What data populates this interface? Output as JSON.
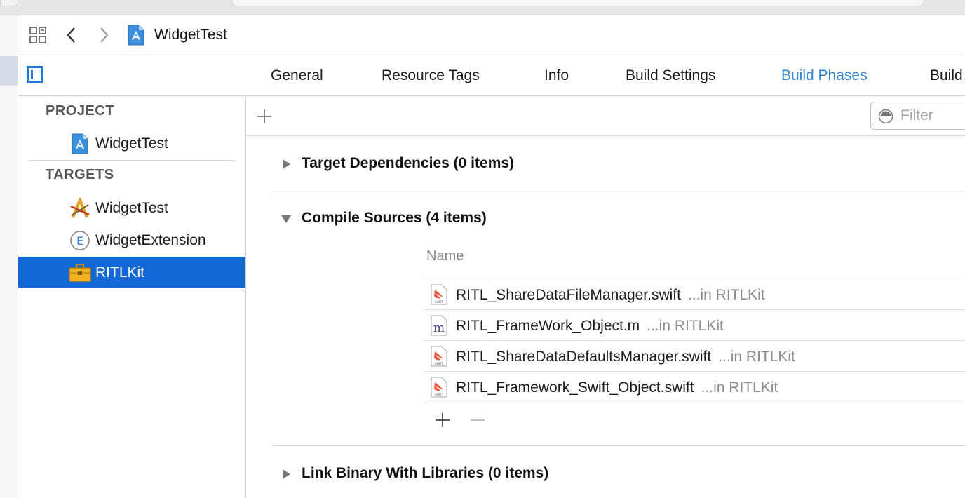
{
  "jumpbar": {
    "title": "WidgetTest"
  },
  "tabs": [
    {
      "label": "General",
      "active": false
    },
    {
      "label": "Resource Tags",
      "active": false
    },
    {
      "label": "Info",
      "active": false
    },
    {
      "label": "Build Settings",
      "active": false
    },
    {
      "label": "Build Phases",
      "active": true
    },
    {
      "label": "Build",
      "active": false
    }
  ],
  "sidebar": {
    "project_header": "PROJECT",
    "project_item": "WidgetTest",
    "targets_header": "TARGETS",
    "targets": [
      {
        "label": "WidgetTest",
        "icon": "app-target-icon",
        "selected": false
      },
      {
        "label": "WidgetExtension",
        "icon": "extension-icon",
        "selected": false
      },
      {
        "label": "RITLKit",
        "icon": "toolbox-icon",
        "selected": true
      }
    ]
  },
  "editor": {
    "filter_placeholder": "Filter",
    "phases": {
      "target_dependencies": "Target Dependencies (0 items)",
      "compile_sources": "Compile Sources (4 items)",
      "link_binary": "Link Binary With Libraries (0 items)"
    },
    "column_header": "Name",
    "files": [
      {
        "name": "RITL_ShareDataFileManager.swift",
        "location": "...in RITLKit",
        "icon": "swift-file-icon"
      },
      {
        "name": "RITL_FrameWork_Object.m",
        "location": "...in RITLKit",
        "icon": "objc-file-icon"
      },
      {
        "name": "RITL_ShareDataDefaultsManager.swift",
        "location": "...in RITLKit",
        "icon": "swift-file-icon"
      },
      {
        "name": "RITL_Framework_Swift_Object.swift",
        "location": "...in RITLKit",
        "icon": "swift-file-icon"
      }
    ]
  },
  "colors": {
    "accent": "#2f86d6",
    "selection": "#1468d6",
    "swift": "#f05138"
  }
}
